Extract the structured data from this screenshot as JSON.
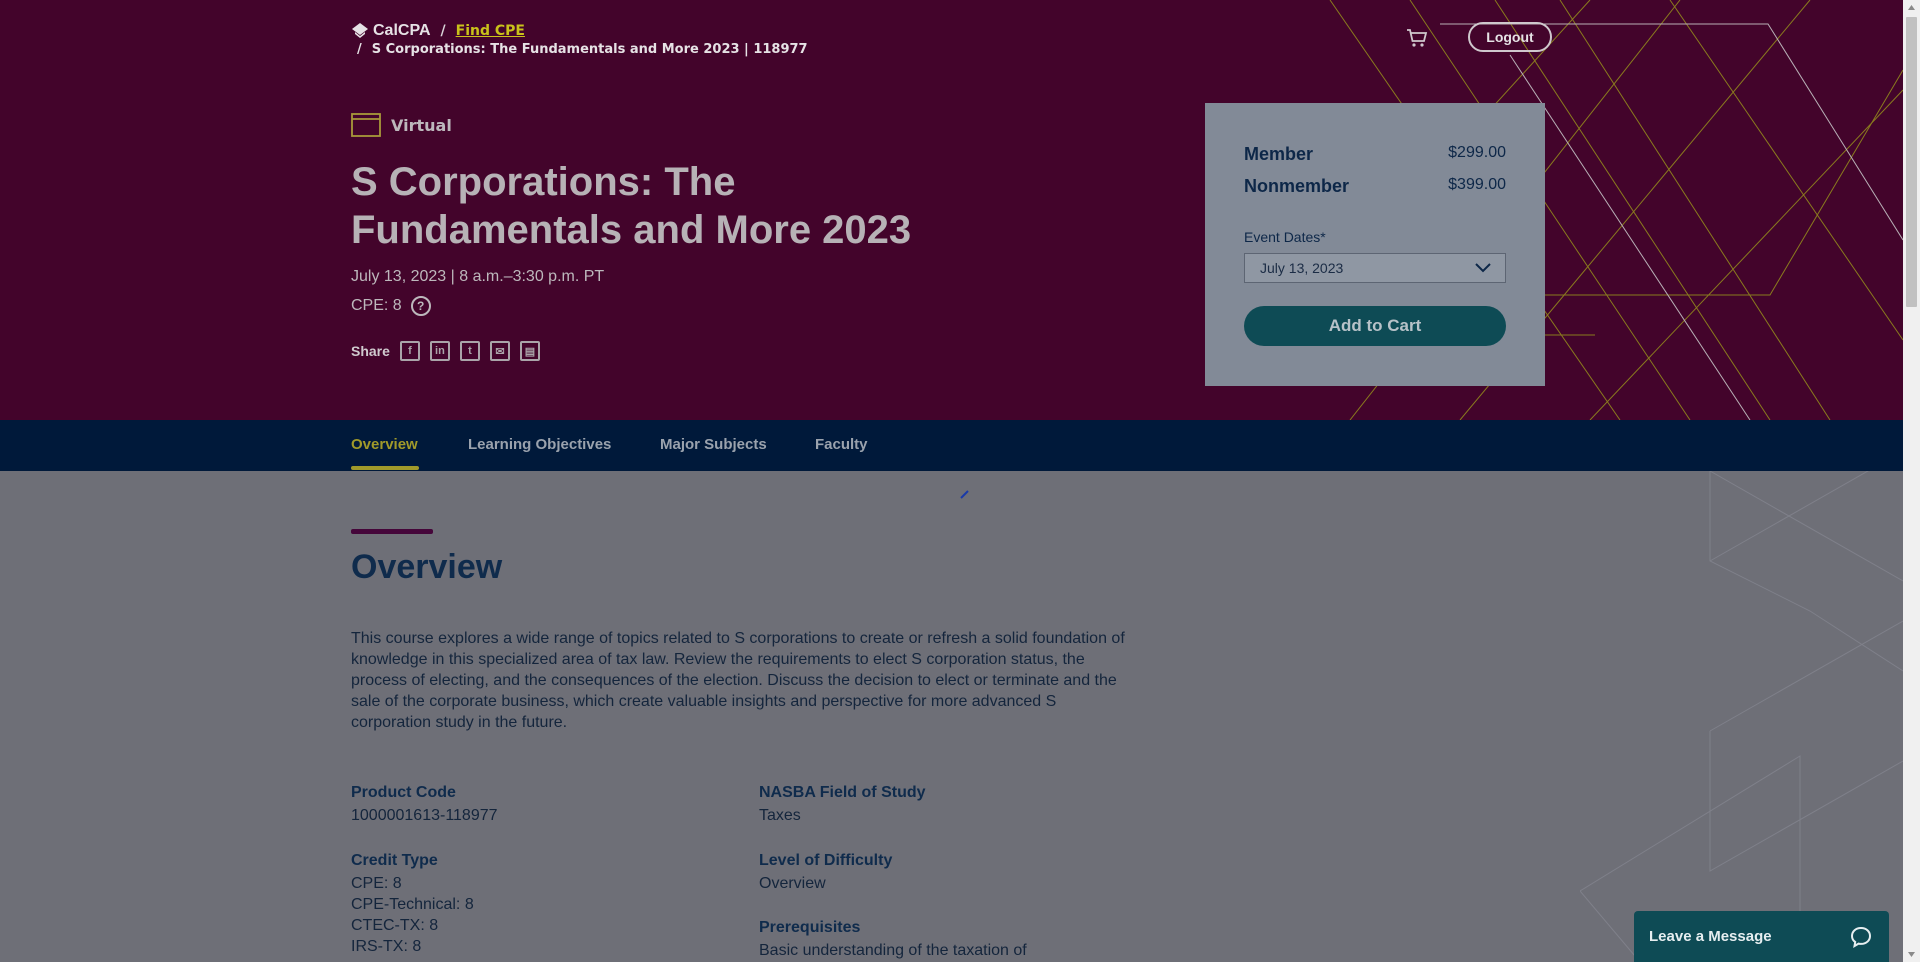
{
  "breadcrumb": {
    "logo_text": "CalCPA",
    "link": "Find CPE",
    "current": "S Corporations: The Fundamentals and More 2023 | 118977"
  },
  "header": {
    "logout": "Logout"
  },
  "event": {
    "format": "Virtual",
    "title": "S Corporations: The Fundamentals and More 2023",
    "date": "July 13, 2023 | 8 a.m.–3:30 p.m. PT",
    "cpe": "CPE: 8",
    "share_label": "Share"
  },
  "pricing": {
    "member_label": "Member",
    "member_price": "$299.00",
    "nonmember_label": "Nonmember",
    "nonmember_price": "$399.00",
    "event_dates_label": "Event Dates*",
    "selected_date": "July 13, 2023",
    "add_to_cart": "Add to Cart"
  },
  "tabs": [
    "Overview",
    "Learning Objectives",
    "Major Subjects",
    "Faculty"
  ],
  "overview": {
    "title": "Overview",
    "description": "This course explores a wide range of topics related to S corporations to create or refresh a solid foundation of knowledge in this specialized area of tax law. Review the requirements to elect S corporation status, the process of electing, and the consequences of the election. Discuss the decision to elect or terminate and the sale of the corporate business, which create valuable insights and perspective for more advanced S corporation study in the future.",
    "product_code_label": "Product Code",
    "product_code": "1000001613-118977",
    "credit_type_label": "Credit Type",
    "credit_types": [
      "CPE: 8",
      "CPE-Technical: 8",
      "CTEC-TX: 8",
      "IRS-TX: 8"
    ],
    "nasba_label": "NASBA Field of Study",
    "nasba": "Taxes",
    "difficulty_label": "Level of Difficulty",
    "difficulty": "Overview",
    "prereq_label": "Prerequisites",
    "prereq": "Basic understanding of the taxation of"
  },
  "chat": {
    "label": "Leave a Message"
  },
  "colors": {
    "hero_bg": "#43042b",
    "nav_bg": "#00193a",
    "accent": "#a09a2a",
    "button_teal": "#0e4b55"
  }
}
